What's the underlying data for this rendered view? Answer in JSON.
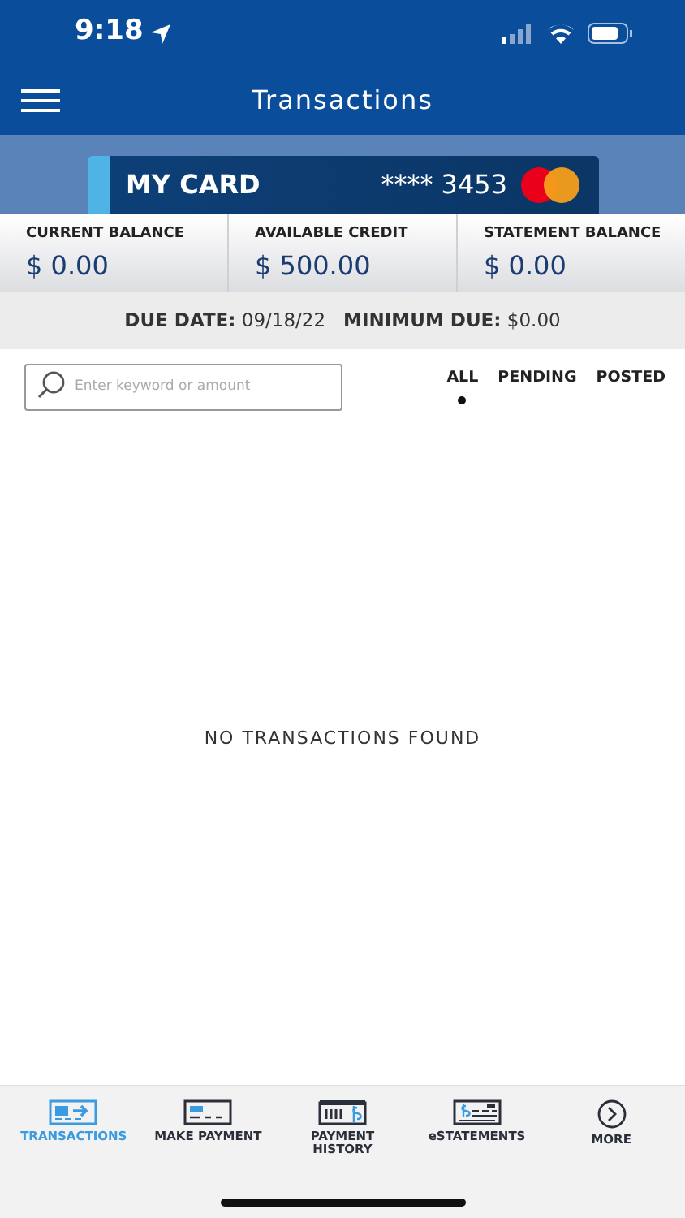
{
  "status_bar": {
    "time": "9:18"
  },
  "header": {
    "title": "Transactions"
  },
  "card": {
    "name": "MY CARD",
    "number": "**** 3453"
  },
  "balances": [
    {
      "label": "CURRENT BALANCE",
      "value": "$ 0.00"
    },
    {
      "label": "AVAILABLE CREDIT",
      "value": "$ 500.00"
    },
    {
      "label": "STATEMENT BALANCE",
      "value": "$ 0.00"
    }
  ],
  "due": {
    "text": "**DUE DATE:** 09/18/22   **MINIMUM DUE:** $0.00"
  },
  "search": {
    "placeholder": "Enter keyword or amount"
  },
  "filters": [
    {
      "label": "ALL",
      "selected": true
    },
    {
      "label": "PENDING",
      "selected": false
    },
    {
      "label": "POSTED",
      "selected": false
    }
  ],
  "empty_message": "NO TRANSACTIONS FOUND",
  "tab_bar": [
    {
      "label": "TRANSACTIONS",
      "kind": "transactions",
      "selected": true
    },
    {
      "label": "MAKE PAYMENT",
      "kind": "payment",
      "selected": false
    },
    {
      "label": "PAYMENT HISTORY",
      "kind": "history",
      "selected": false
    },
    {
      "label": "eSTATEMENTS",
      "kind": "statements",
      "selected": false
    },
    {
      "label": "MORE",
      "kind": "more",
      "selected": false
    }
  ]
}
